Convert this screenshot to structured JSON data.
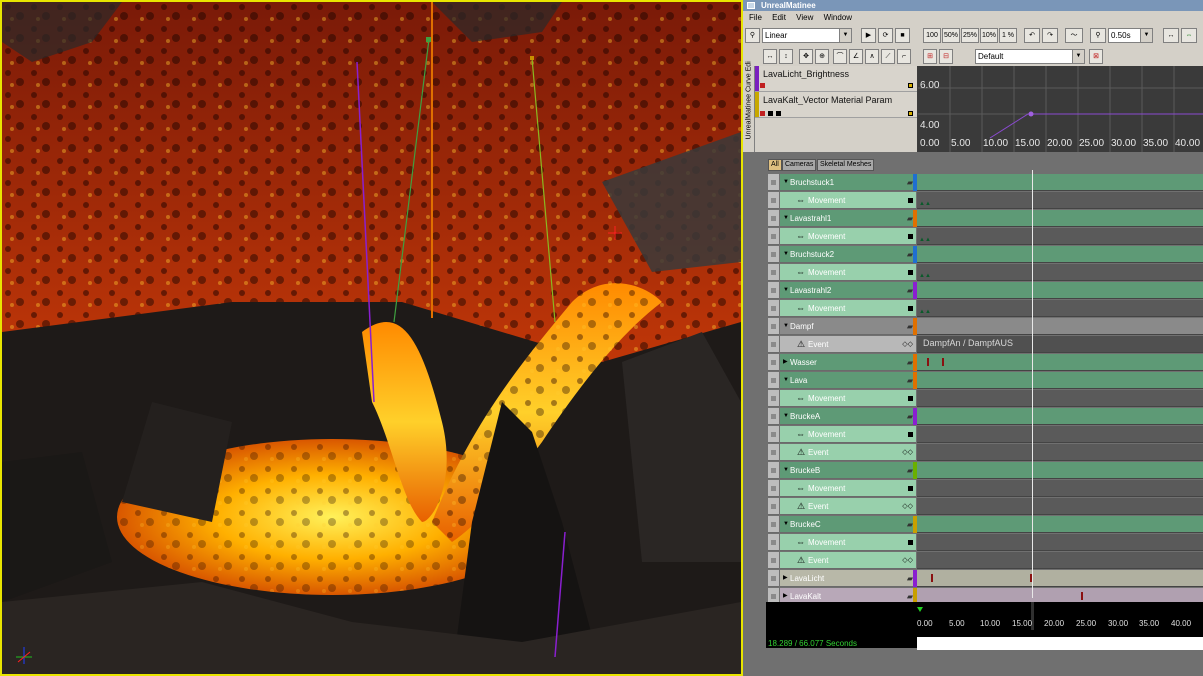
{
  "app": {
    "window_title": "UnrealMatinee",
    "menu": [
      "File",
      "Edit",
      "View",
      "Window"
    ]
  },
  "toolbar": {
    "interp_mode": "Linear",
    "speed_buttons": [
      "100",
      "50%",
      "25%",
      "10%",
      "1 %"
    ],
    "snap_value": "0.50s",
    "curve_preset": "Default"
  },
  "curve_editor": {
    "tab_label": "UnrealMatinee Curve Edi",
    "curves": [
      {
        "label": "LavaLicht_Brightness",
        "color": "#7a1fbf"
      },
      {
        "label": "LavaKalt_Vector Material Param",
        "color": "#c8a800"
      }
    ],
    "y_labels": [
      "6.00",
      "4.00"
    ],
    "x_labels": [
      "0.00",
      "5.00",
      "10.00",
      "15.00",
      "20.00",
      "25.00",
      "30.00",
      "35.00",
      "40.00"
    ]
  },
  "tabs": [
    "All",
    "Cameras",
    "Skeletal Meshes"
  ],
  "tracks": [
    {
      "label": "Bruchstuck1",
      "type": "group",
      "color": "#1f6fd0"
    },
    {
      "label": "Movement",
      "type": "track",
      "color": ""
    },
    {
      "label": "Lavastrahl1",
      "type": "group",
      "color": "#e07000"
    },
    {
      "label": "Movement",
      "type": "track",
      "color": ""
    },
    {
      "label": "Bruchstuck2",
      "type": "group",
      "color": "#1f6fd0"
    },
    {
      "label": "Movement",
      "type": "track",
      "color": ""
    },
    {
      "label": "Lavastrahl2",
      "type": "group",
      "color": "#8a1fd0"
    },
    {
      "label": "Movement",
      "type": "track",
      "color": ""
    },
    {
      "label": "Dampf",
      "type": "group-gray",
      "color": "#e07000"
    },
    {
      "label": "Event",
      "type": "event-sel",
      "color": ""
    },
    {
      "label": "Wasser",
      "type": "group-collapsed",
      "color": "#e07000"
    },
    {
      "label": "Lava",
      "type": "group",
      "color": "#e07000"
    },
    {
      "label": "Movement",
      "type": "track",
      "color": ""
    },
    {
      "label": "BruckeA",
      "type": "group",
      "color": "#8a1fd0"
    },
    {
      "label": "Movement",
      "type": "track",
      "color": ""
    },
    {
      "label": "Event",
      "type": "event",
      "color": ""
    },
    {
      "label": "BruckeB",
      "type": "group",
      "color": "#6ab000"
    },
    {
      "label": "Movement",
      "type": "track",
      "color": ""
    },
    {
      "label": "Event",
      "type": "event",
      "color": ""
    },
    {
      "label": "BruckeC",
      "type": "group",
      "color": "#c8a000"
    },
    {
      "label": "Movement",
      "type": "track",
      "color": ""
    },
    {
      "label": "Event",
      "type": "event",
      "color": ""
    },
    {
      "label": "LavaLicht",
      "type": "light",
      "color": "#8a1fd0"
    },
    {
      "label": "LavaKalt",
      "type": "material",
      "color": "#c8a000"
    }
  ],
  "event_text": "DampfAn / DampfAUS",
  "timeline": {
    "labels": [
      "0.00",
      "5.00",
      "10.00",
      "15.00",
      "20.00",
      "25.00",
      "30.00",
      "35.00",
      "40.00"
    ],
    "status": "18.289 / 66.077 Seconds"
  }
}
